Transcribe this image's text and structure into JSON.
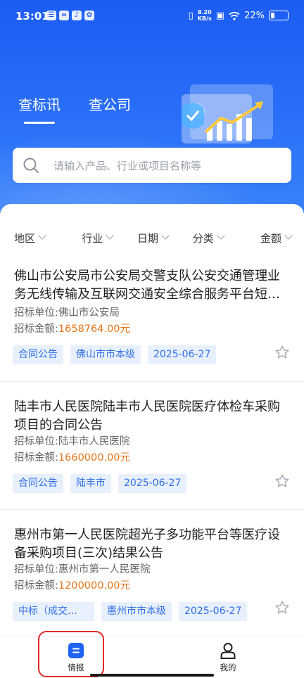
{
  "status_bar": {
    "time": "13:01",
    "speed_top": "8.20",
    "speed_bottom": "KB/s",
    "battery": "22%"
  },
  "header": {
    "tabs": [
      {
        "label": "查标讯",
        "active": true
      },
      {
        "label": "查公司",
        "active": false
      }
    ]
  },
  "search": {
    "placeholder": "请输入产品、行业或项目名称等"
  },
  "filters": [
    {
      "label": "地区"
    },
    {
      "label": "行业"
    },
    {
      "label": "日期"
    },
    {
      "label": "分类"
    },
    {
      "label": "金额"
    }
  ],
  "listing": [
    {
      "title": "佛山市公安局市公安局交警支队公安交通管理业务无线传输及互联网交通安全综合服务平台短信服务项目",
      "unit_label": "招标单位:",
      "unit": "佛山市公安局",
      "amount_label": "招标金额:",
      "amount": "1658764.00元",
      "tags": [
        "合同公告",
        "佛山市市本级",
        "2025-06-27"
      ]
    },
    {
      "title": "陆丰市人民医院陆丰市人民医院医疗体检车采购项目的合同公告",
      "unit_label": "招标单位:",
      "unit": "陆丰市人民医院",
      "amount_label": "招标金额:",
      "amount": "1660000.00元",
      "tags": [
        "合同公告",
        "陆丰市",
        "2025-06-27"
      ]
    },
    {
      "title": "惠州市第一人民医院超光子多功能平台等医疗设备采购项目(三次)结果公告",
      "unit_label": "招标单位:",
      "unit": "惠州市第一人民医院",
      "amount_label": "招标金额:",
      "amount": "1200000.00元",
      "tags": [
        "中标（成交…",
        "惠州市市本级",
        "2025-06-27"
      ]
    }
  ],
  "bottom_nav": [
    {
      "label": "情报",
      "icon": "news-icon",
      "active": true
    },
    {
      "label": "我的",
      "icon": "person-icon",
      "active": false
    }
  ],
  "colors": {
    "brand_blue": "#2a6ff7",
    "amount_orange": "#e8751a",
    "tag_text": "#2f6fe4",
    "tag_bg": "#e8f0fd",
    "highlight_red": "#e22a2a"
  }
}
